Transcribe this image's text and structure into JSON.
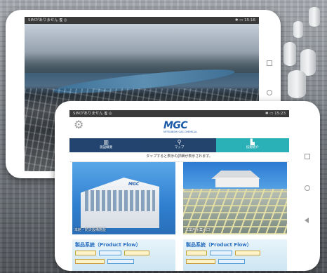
{
  "tablet_back": {
    "status_left": "SIMがありません 🖫 ◎",
    "status_right": "✱ ▭ 15:16"
  },
  "tablet_front": {
    "status_left": "SIMがありません 🖫 ◎",
    "status_right": "✱ ▭ 15:23",
    "logo": "MGC",
    "logo_sub": "MITSUBISHI GAS CHEMICAL",
    "settings_icon": "gear-icon",
    "tabs": [
      {
        "label": "施設概要",
        "icon": "building-icon",
        "color": "#23446e"
      },
      {
        "label": "マップ",
        "icon": "map-pin-icon",
        "color": "#22446d"
      },
      {
        "label": "技術紹介",
        "icon": "factory-icon",
        "color": "#2ab0b7"
      }
    ],
    "notice": "タップすると表示の詳細が表示されます。",
    "cards": [
      {
        "caption": "本館・防災設備施設"
      },
      {
        "caption": "工業用水集水口"
      },
      {
        "title": "製品系統（Product Flow）"
      },
      {
        "title": "製品系統（Product Flow）"
      }
    ],
    "building_logo": "MGC"
  }
}
